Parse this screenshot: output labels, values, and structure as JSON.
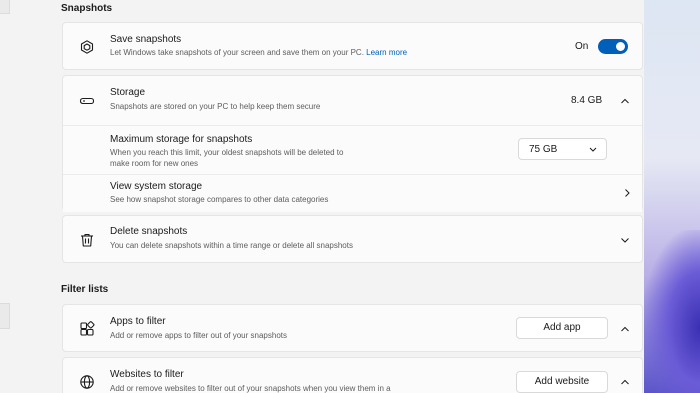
{
  "sections": {
    "snapshots_title": "Snapshots",
    "filter_lists_title": "Filter lists"
  },
  "save_snapshots": {
    "title": "Save snapshots",
    "desc": "Let Windows take snapshots of your screen and save them on your PC.",
    "link": "Learn more",
    "toggle_label": "On",
    "toggle_state": true
  },
  "storage": {
    "title": "Storage",
    "desc": "Snapshots are stored on your PC to help keep them secure",
    "value": "8.4 GB",
    "max": {
      "title": "Maximum storage for snapshots",
      "desc_line1": "When you reach this limit, your oldest snapshots will be deleted to",
      "desc_line2": "make room for new ones",
      "selected": "75 GB"
    },
    "system": {
      "title": "View system storage",
      "desc": "See how snapshot storage compares to other data categories"
    }
  },
  "delete": {
    "title": "Delete snapshots",
    "desc": "You can delete snapshots within a time range or delete all snapshots"
  },
  "apps": {
    "title": "Apps to filter",
    "desc": "Add or remove apps to filter out of your snapshots",
    "button": "Add app"
  },
  "websites": {
    "title": "Websites to filter",
    "desc": "Add or remove websites to filter out of your snapshots when you view them in a",
    "button": "Add website"
  },
  "icons": {
    "save": "snapshot-cube-icon",
    "storage": "drive-icon",
    "delete": "trash-icon",
    "apps": "apps-grid-icon",
    "websites": "globe-icon",
    "chevron_up": "chevron-up-icon",
    "chevron_down": "chevron-down-icon",
    "chevron_right": "chevron-right-icon"
  },
  "colors": {
    "accent": "#005fb8",
    "background": "#f3f3f3",
    "card": "#fbfbfb"
  }
}
